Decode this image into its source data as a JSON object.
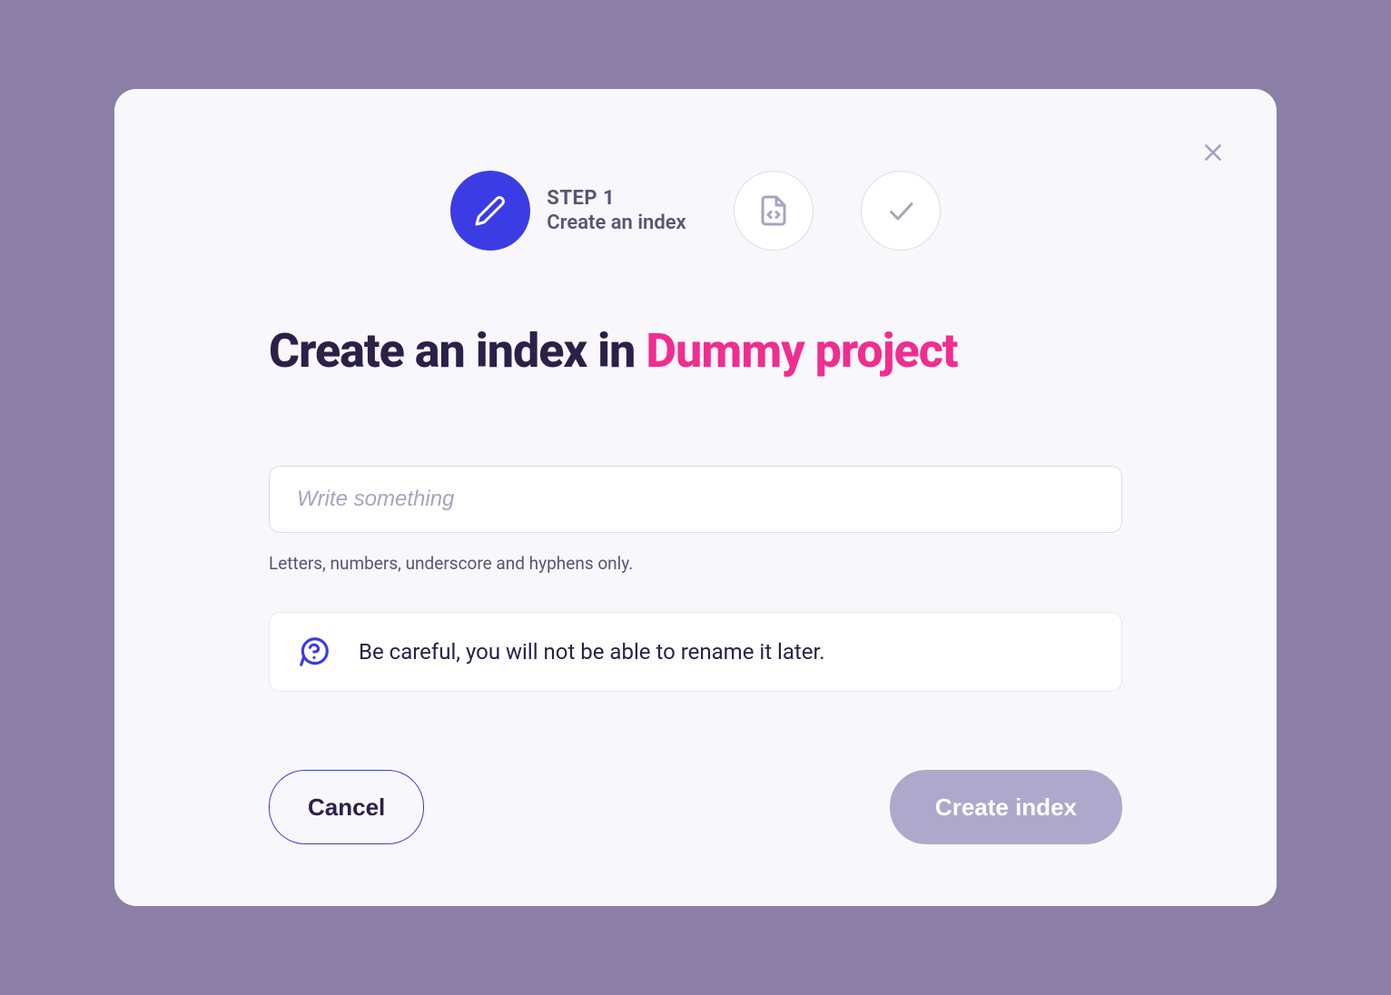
{
  "stepper": {
    "step1": {
      "label": "STEP 1",
      "desc": "Create an index"
    }
  },
  "title": {
    "prefix": "Create an index in ",
    "project": "Dummy project"
  },
  "input": {
    "placeholder": "Write something",
    "value": "",
    "helper": "Letters, numbers, underscore and hyphens only."
  },
  "warning": {
    "text": "Be careful, you will not be able to rename it later."
  },
  "buttons": {
    "cancel": "Cancel",
    "create": "Create index"
  }
}
